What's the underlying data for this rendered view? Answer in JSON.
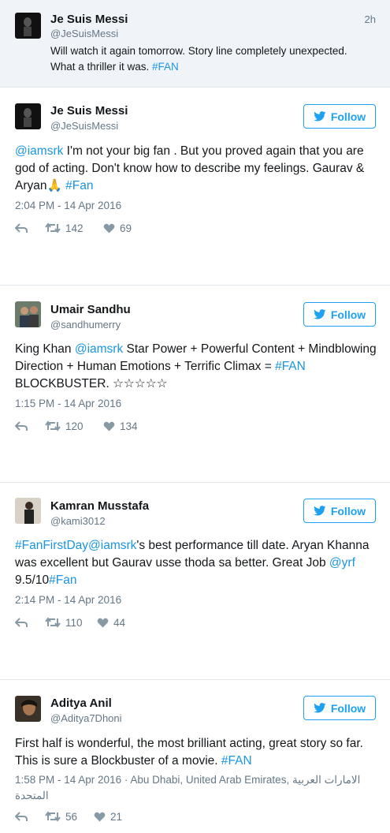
{
  "reply": {
    "name": "Je Suis Messi",
    "handle": "@JeSuisMessi",
    "time": "2h",
    "text_line1": "Will watch it again tomorrow. Story line completely unexpected.",
    "text_line2": "What a thriller it was. ",
    "hashtag": "#FAN"
  },
  "follow_label": "Follow",
  "tweets": [
    {
      "name": "Je Suis Messi",
      "handle": "@JeSuisMessi",
      "mention": "@iamsrk",
      "text_a": " I'm not your big fan . But you proved again that you are god of acting. Don't know how to describe my feelings. Gaurav & Aryan",
      "emoji": "🙏",
      "hashtag": "#Fan",
      "date": "2:04 PM - 14 Apr 2016",
      "retweets": "142",
      "likes": "69"
    },
    {
      "name": "Umair Sandhu",
      "handle": "@sandhumerry",
      "text_a": "King Khan ",
      "mention": "@iamsrk",
      "text_b": " Star Power + Powerful Content + Mindblowing Direction + Human Emotions + Terrific Climax = ",
      "hashtag": "#FAN",
      "text_c": " BLOCKBUSTER. ☆☆☆☆☆",
      "date": "1:15 PM - 14 Apr 2016",
      "retweets": "120",
      "likes": "134"
    },
    {
      "name": "Kamran Musstafa",
      "handle": "@kami3012",
      "hashtag1": "#FanFirstDay",
      "mention": "@iamsrk",
      "text_a": "'s best performance till date. Aryan Khanna was excellent but Gaurav usse thoda sa better. Great Job ",
      "mention2": "@yrf",
      "text_b": " 9.5/10",
      "hashtag2": "#Fan",
      "date": "2:14 PM - 14 Apr 2016",
      "retweets": "110",
      "likes": "44"
    },
    {
      "name": "Aditya Anil",
      "handle": "@Aditya7Dhoni",
      "text_a": "First half is wonderful, the most brilliant acting, great story so far. This is sure a Blockbuster of a movie. ",
      "hashtag": "#FAN",
      "date": "1:58 PM - 14 Apr 2016 · Abu Dhabi, United Arab Emirates, الامارات العربية المتحدة",
      "retweets": "56",
      "likes": "21"
    }
  ],
  "colors": {
    "link": "#1b95e0",
    "follow": "#1da1f2",
    "muted": "#657786"
  }
}
